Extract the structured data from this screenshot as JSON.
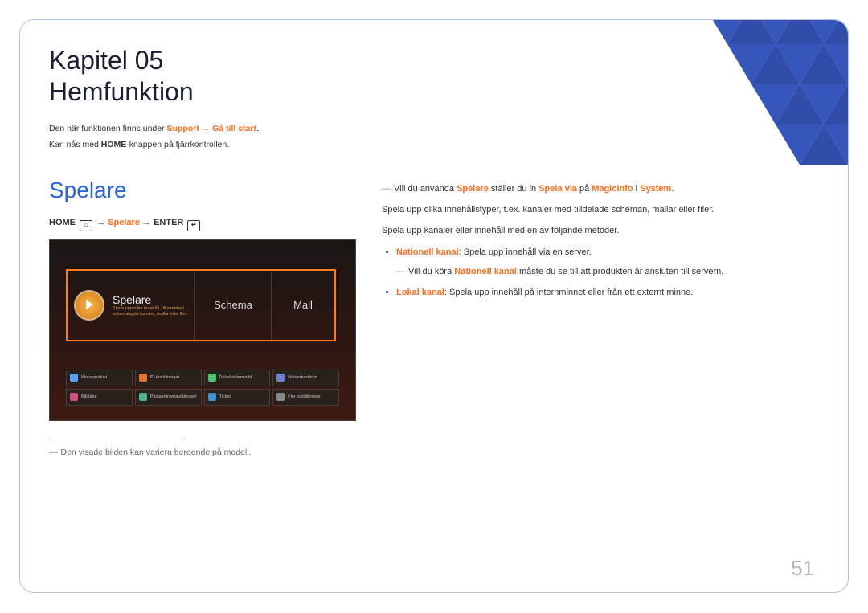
{
  "header": {
    "chapter_label": "Kapitel",
    "chapter_number": "05",
    "chapter_title": "Hemfunktion",
    "note_line1_pre": "Den här funktionen finns under ",
    "note_line1_hl1": "Support",
    "note_line1_arrow": " → ",
    "note_line1_hl2": "Gå till start",
    "note_line1_end": ".",
    "note_line2_pre": "Kan nås med ",
    "note_line2_bold": "HOME",
    "note_line2_post": "-knappen på fjärrkontrollen."
  },
  "left": {
    "section_title": "Spelare",
    "breadcrumb": {
      "home": "HOME",
      "arrow1": " → ",
      "spelare": "Spelare",
      "arrow2": " →",
      "enter": "ENTER"
    },
    "tv": {
      "main_title": "Spelare",
      "main_sub": "Spela upp olika innehåll, till exempel schemalagda kanaler, mallar eller filer.",
      "schema": "Schema",
      "mall": "Mall",
      "cells": [
        "Klonaprodukt",
        "ID-inställningar",
        "Delad skärmvidd",
        "Nätverksstatus",
        "Bildläge",
        "Påslagnings/avstängsel",
        "Ticker",
        "Fler inställningar"
      ]
    },
    "footnote": "Den visade bilden kan variera beroende på modell."
  },
  "right": {
    "line1_dash": "―",
    "line1_pre": "Vill du använda ",
    "line1_b1": "Spelare",
    "line1_mid1": " ställer du in ",
    "line1_b2": "Spela via",
    "line1_mid2": " på ",
    "line1_b3": "MagicInfo",
    "line1_mid3": " i ",
    "line1_b4": "System",
    "line1_end": ".",
    "para2": "Spela upp olika innehållstyper, t.ex. kanaler med tilldelade scheman, mallar eller filer.",
    "para3": "Spela upp kanaler eller innehåll med en av följande metoder.",
    "bullet1_label": "Nationell kanal",
    "bullet1_text": ": Spela upp innehåll via en server.",
    "bullet1_note_dash": "―",
    "bullet1_note_pre": "Vill du köra ",
    "bullet1_note_b": "Nationell kanal",
    "bullet1_note_post": " måste du se till att produkten är ansluten till servern.",
    "bullet2_label": "Lokal kanal",
    "bullet2_text": ": Spela upp innehåll på internminnet eller från ett externt minne."
  },
  "page_number": "51"
}
